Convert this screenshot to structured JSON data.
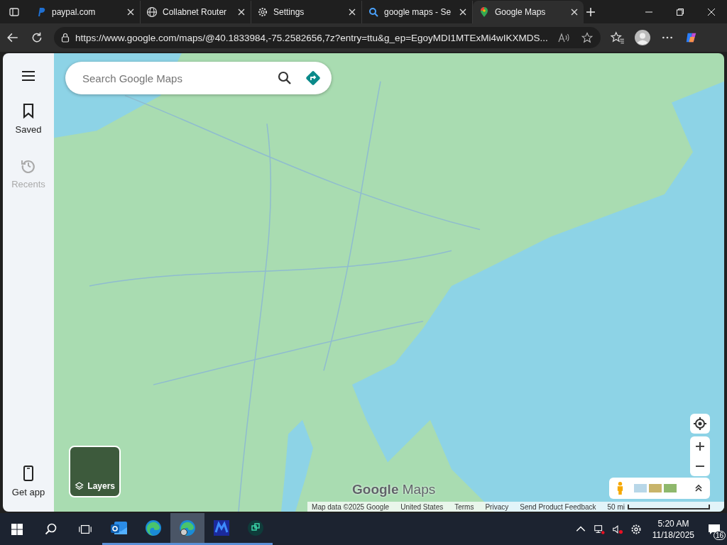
{
  "browser": {
    "tabs": [
      {
        "label": "paypal.com",
        "kind": "paypal",
        "selected": false
      },
      {
        "label": "Collabnet Router",
        "kind": "globe",
        "selected": false
      },
      {
        "label": "Settings",
        "kind": "gear",
        "selected": false
      },
      {
        "label": "google maps - Se",
        "kind": "search",
        "selected": false
      },
      {
        "label": "Google Maps",
        "kind": "maps",
        "selected": true
      }
    ],
    "url": "https://www.google.com/maps/@40.1833984,-75.2582656,7z?entry=ttu&g_ep=EgoyMDI1MTExMi4wIKXMDS..."
  },
  "sidebar": {
    "items": [
      {
        "label": "Saved",
        "kind": "saved",
        "disabled": false
      },
      {
        "label": "Recents",
        "kind": "recents",
        "disabled": true
      }
    ],
    "get_app": "Get app"
  },
  "search": {
    "placeholder": "Search Google Maps"
  },
  "layers": {
    "label": "Layers"
  },
  "logo": {
    "brand": "Google",
    "product": "Maps"
  },
  "footer": [
    "Map data ©2025 Google",
    "United States",
    "Terms",
    "Privacy",
    "Send Product Feedback"
  ],
  "scale": "50 mi",
  "taskbar": {
    "apps": [
      {
        "kind": "outlook",
        "selected": false
      },
      {
        "kind": "edge",
        "selected": false
      },
      {
        "kind": "edge-profile",
        "selected": true
      },
      {
        "kind": "m-app",
        "selected": false
      },
      {
        "kind": "box-app",
        "selected": false
      }
    ],
    "time": "5:20 AM",
    "date": "11/18/2025",
    "notifications": "16"
  }
}
